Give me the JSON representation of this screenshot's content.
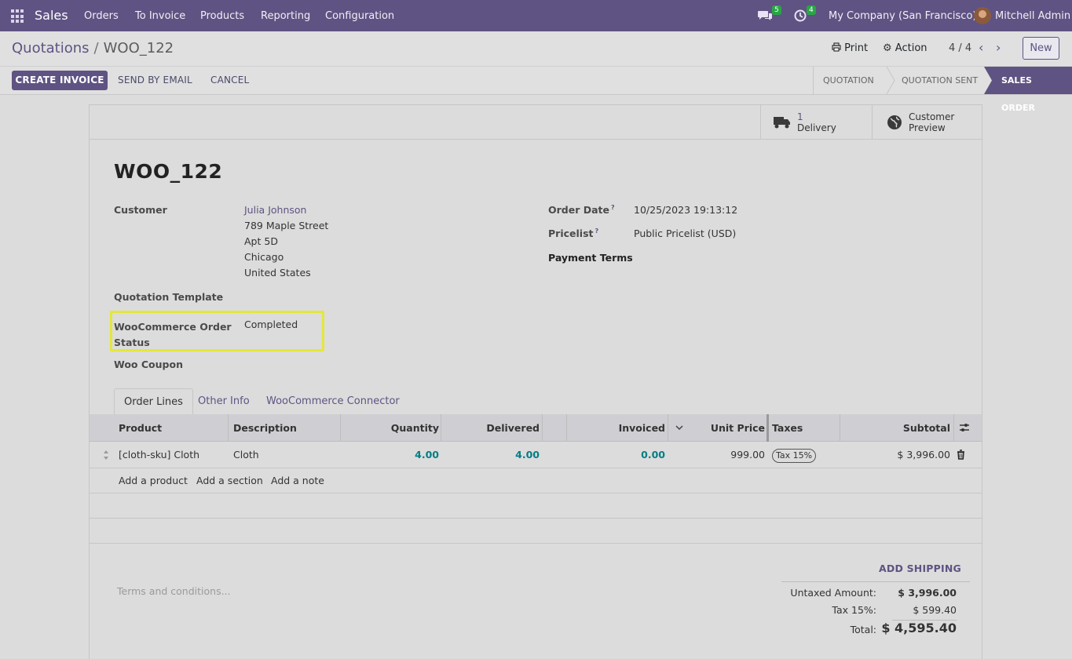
{
  "navbar": {
    "app_name": "Sales",
    "menu": [
      "Orders",
      "To Invoice",
      "Products",
      "Reporting",
      "Configuration"
    ],
    "messages_count": "5",
    "activities_count": "4",
    "company": "My Company (San Francisco)",
    "user": "Mitchell Admin"
  },
  "breadcrumb": {
    "parent": "Quotations",
    "separator": "/",
    "current": "WOO_122"
  },
  "control": {
    "print": "Print",
    "action": "Action",
    "pager": "4 / 4",
    "new": "New",
    "create_invoice": "CREATE INVOICE",
    "send_email": "SEND BY EMAIL",
    "cancel": "CANCEL",
    "statuses": [
      "QUOTATION",
      "QUOTATION SENT",
      "SALES ORDER"
    ]
  },
  "smart_buttons": {
    "delivery_count": "1",
    "delivery_label": "Delivery",
    "preview_line1": "Customer",
    "preview_line2": "Preview"
  },
  "form": {
    "title": "WOO_122",
    "customer_label": "Customer",
    "customer_name": "Julia Johnson",
    "address": [
      "789 Maple Street",
      "Apt 5D",
      "Chicago",
      "United States"
    ],
    "quotation_template_label": "Quotation Template",
    "woo_status_label_1": "WooCommerce Order",
    "woo_status_label_2": "Status",
    "woo_status_value": "Completed",
    "woo_coupon_label": "Woo Coupon",
    "order_date_label": "Order Date",
    "order_date_value": "10/25/2023 19:13:12",
    "pricelist_label": "Pricelist",
    "pricelist_value": "Public Pricelist (USD)",
    "payment_terms_label": "Payment Terms",
    "help_mark": "?"
  },
  "tabs": [
    "Order Lines",
    "Other Info",
    "WooCommerce Connector"
  ],
  "table": {
    "headers": {
      "product": "Product",
      "description": "Description",
      "quantity": "Quantity",
      "delivered": "Delivered",
      "invoiced": "Invoiced",
      "unit_price": "Unit Price",
      "taxes": "Taxes",
      "subtotal": "Subtotal"
    },
    "rows": [
      {
        "product": "[cloth-sku] Cloth",
        "description": "Cloth",
        "quantity": "4.00",
        "delivered": "4.00",
        "invoiced": "0.00",
        "unit_price": "999.00",
        "taxes": "Tax 15%",
        "subtotal": "$ 3,996.00"
      }
    ],
    "add_product": "Add a product",
    "add_section": "Add a section",
    "add_note": "Add a note"
  },
  "footer": {
    "terms_placeholder": "Terms and conditions...",
    "add_shipping": "ADD SHIPPING",
    "untaxed_label": "Untaxed Amount:",
    "untaxed_value": "$ 3,996.00",
    "tax_label": "Tax 15%:",
    "tax_value": "$ 599.40",
    "total_label": "Total:",
    "total_value": "$ 4,595.40"
  },
  "colors": {
    "brand": "#5f5383",
    "accent_number": "#017e84",
    "highlight": "#e3e73a"
  }
}
